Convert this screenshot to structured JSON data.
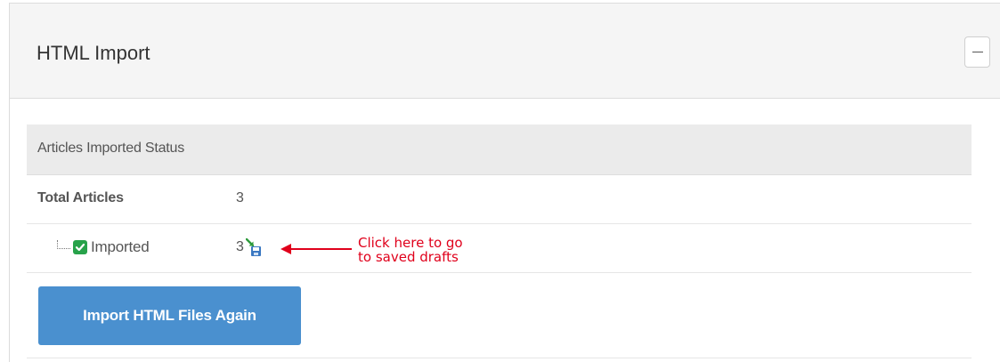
{
  "panel": {
    "title": "HTML Import",
    "collapse_icon": "minus-icon"
  },
  "status_table": {
    "header": "Articles Imported Status",
    "rows": [
      {
        "label": "Total Articles",
        "value": "3"
      },
      {
        "label": "Imported",
        "value": "3",
        "status_icon": "checkbox-checked-icon",
        "action_icon": "saved-drafts-icon"
      }
    ]
  },
  "annotation": {
    "line1": "Click here to go",
    "line2": "to saved drafts",
    "color": "#e0001b"
  },
  "actions": {
    "import_again_label": "Import HTML Files Again",
    "button_color": "#4a90cf"
  }
}
